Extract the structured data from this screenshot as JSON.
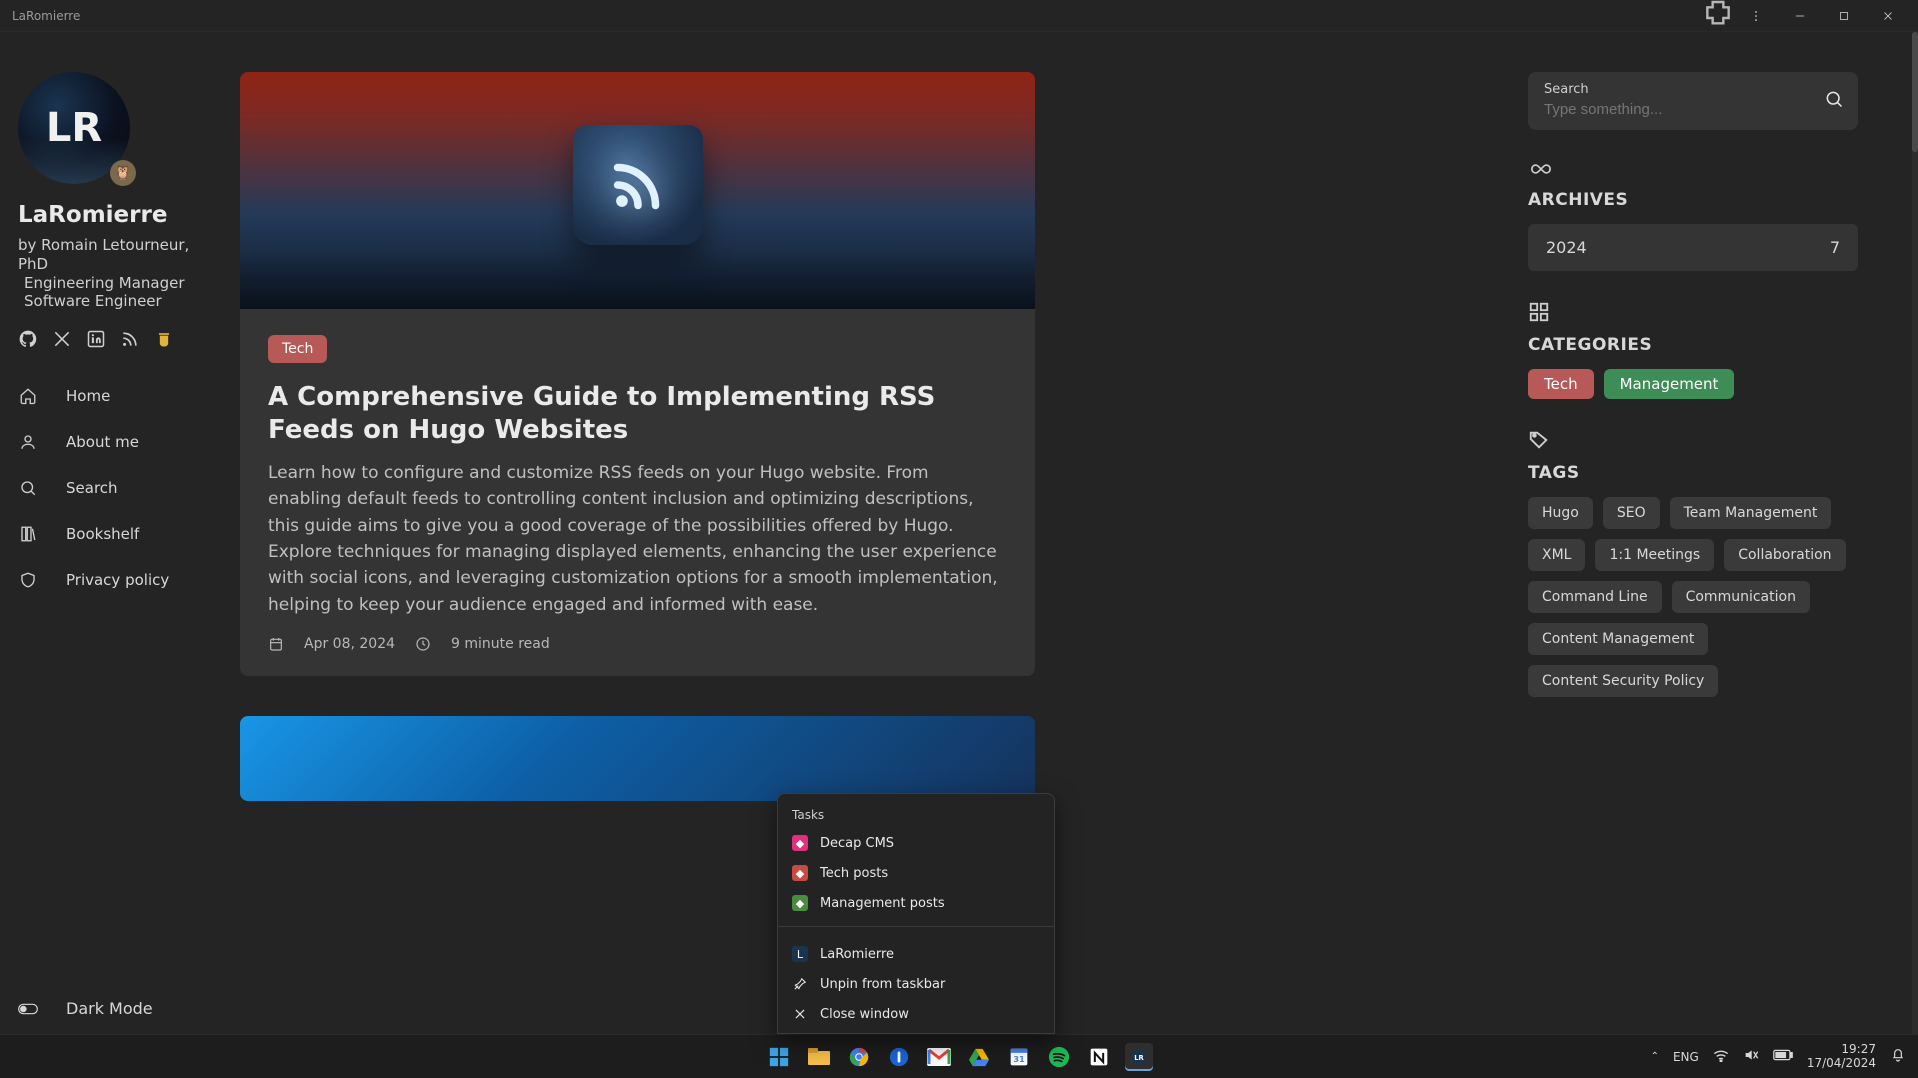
{
  "window": {
    "title": "LaRomierre"
  },
  "profile": {
    "avatar_text": "LR",
    "site_title": "LaRomierre",
    "byline1": "by Romain Letourneur, PhD",
    "byline2": "Engineering Manager",
    "byline3": "Software Engineer"
  },
  "nav": {
    "home": "Home",
    "about": "About me",
    "search": "Search",
    "bookshelf": "Bookshelf",
    "privacy": "Privacy policy",
    "darkmode": "Dark Mode"
  },
  "post": {
    "category": "Tech",
    "title": "A Comprehensive Guide to Implementing RSS Feeds on Hugo Websites",
    "description": "Learn how to configure and customize RSS feeds on your Hugo website. From enabling default feeds to controlling content inclusion and optimizing descriptions, this guide aims to give you a good coverage of the possibilities offered by Hugo. Explore techniques for managing displayed elements, enhancing the user experience with social icons, and leveraging customization options for a smooth implementation, helping to keep your audience engaged and informed with ease.",
    "date": "Apr 08, 2024",
    "read_time": "9 minute read"
  },
  "search": {
    "label": "Search",
    "placeholder": "Type something..."
  },
  "archives": {
    "title": "ARCHIVES",
    "items": [
      {
        "year": "2024",
        "count": "7"
      }
    ]
  },
  "categories": {
    "title": "CATEGORIES",
    "tech": "Tech",
    "management": "Management"
  },
  "tags": {
    "title": "TAGS",
    "items": [
      "Hugo",
      "SEO",
      "Team Management",
      "XML",
      "1:1 Meetings",
      "Collaboration",
      "Command Line",
      "Communication",
      "Content Management",
      "Content Security Policy"
    ]
  },
  "jumplist": {
    "tasks_header": "Tasks",
    "tasks": [
      {
        "label": "Decap CMS",
        "color": "#e0317d"
      },
      {
        "label": "Tech posts",
        "color": "#c84a45"
      },
      {
        "label": "Management posts",
        "color": "#4a8c3e"
      }
    ],
    "app": "LaRomierre",
    "unpin": "Unpin from taskbar",
    "close": "Close window"
  },
  "systray": {
    "lang": "ENG",
    "time": "19:27",
    "date": "17/04/2024"
  }
}
